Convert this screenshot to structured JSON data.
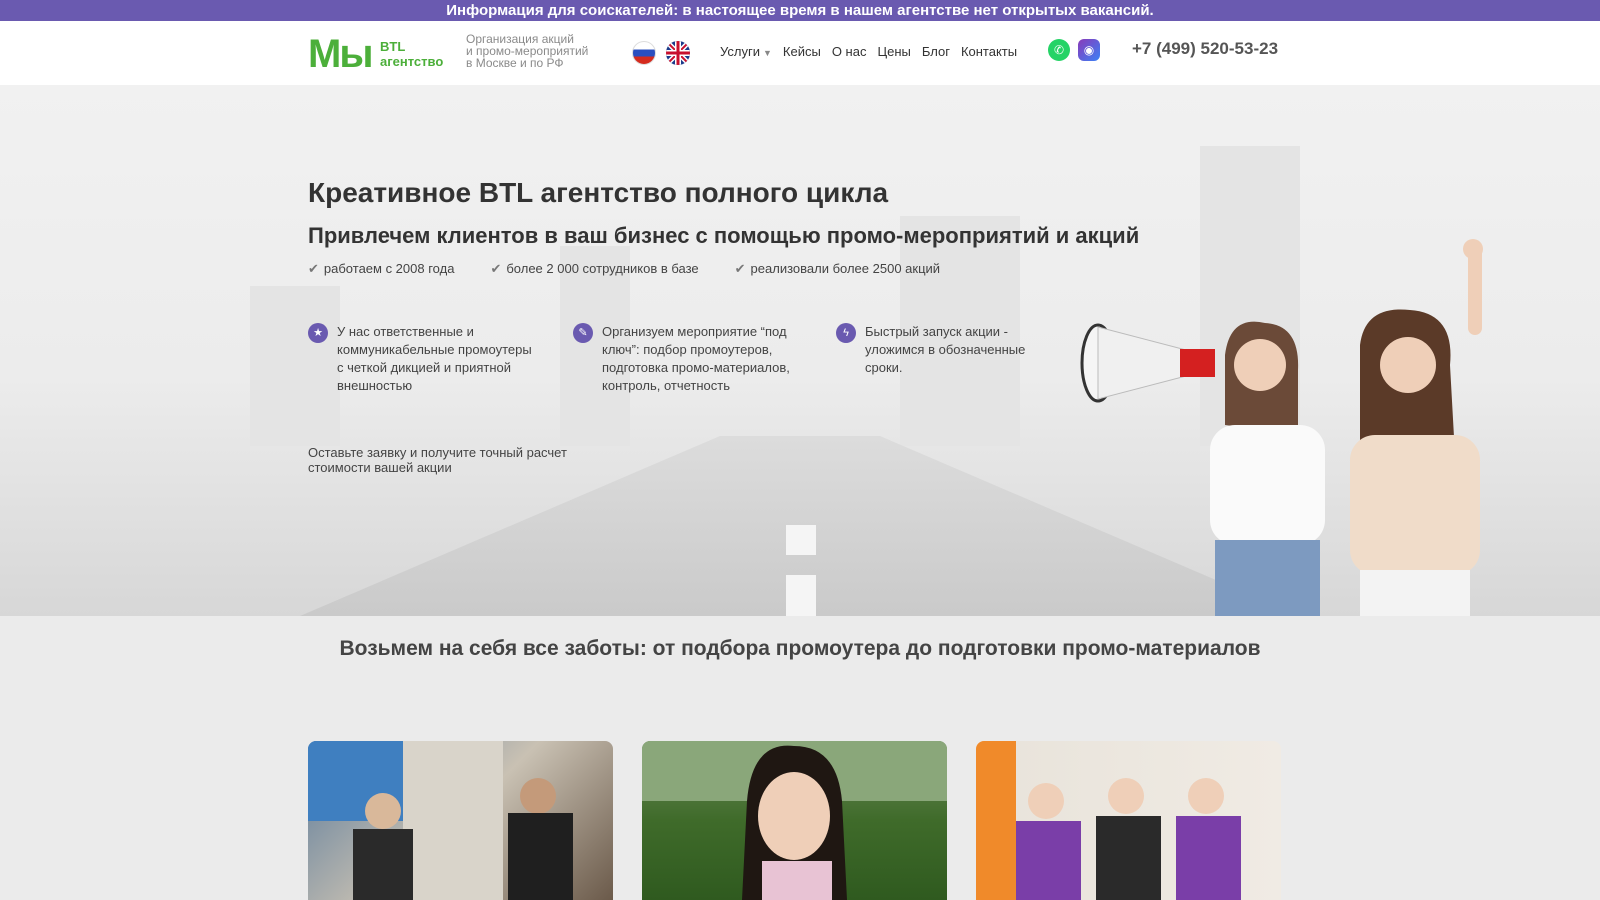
{
  "banner": {
    "text": "Информация для соискателей: в настоящее время в нашем агентстве нет открытых вакансий."
  },
  "header": {
    "logo_main": "Мы",
    "logo_sub_1": "BTL",
    "logo_sub_2": "агентство",
    "tagline_1": "Организация акций",
    "tagline_2": "и промо-мероприятий",
    "tagline_3": "в Москве и по РФ",
    "nav": [
      {
        "label": "Услуги"
      },
      {
        "label": "Кейсы"
      },
      {
        "label": "О нас"
      },
      {
        "label": "Цены"
      },
      {
        "label": "Блог"
      },
      {
        "label": "Контакты"
      }
    ],
    "phone": "+7 (499) 520-53-23"
  },
  "hero": {
    "title": "Креативное BTL агентство полного цикла",
    "subtitle": "Привлечем клиентов в ваш бизнес с помощью промо-мероприятий и акций",
    "bullets": [
      "работаем с 2008 года",
      "более 2 000 сотрудников в базе",
      "реализовали более 2500 акций"
    ],
    "features": [
      {
        "icon": "star-icon",
        "text": "У нас ответственные и коммуникабельные промоутеры с четкой дикцией и приятной внешностью"
      },
      {
        "icon": "wrench-icon",
        "text": "Организуем мероприятие “под ключ”: подбор промоутеров, подготовка промо-материалов, контроль, отчетность"
      },
      {
        "icon": "bolt-icon",
        "text": "Быстрый запуск акции - уложимся в обозначенные сроки."
      }
    ],
    "cta": "Оставьте заявку и получите точный расчет стоимости вашей акции"
  },
  "section": {
    "title": "Возьмем на себя все заботы: от подбора промоутера до подготовки промо-материалов"
  },
  "colors": {
    "banner": "#6a5ab0",
    "logo_green": "#4caf3a",
    "accent_purple": "#6a5ab0"
  }
}
